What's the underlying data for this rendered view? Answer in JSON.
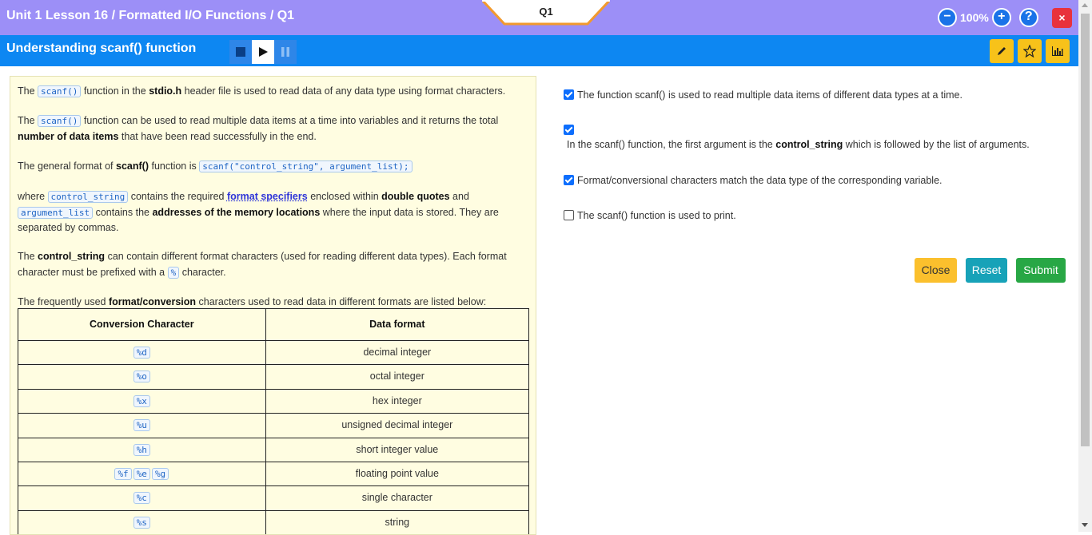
{
  "header": {
    "breadcrumb": "Unit 1 Lesson 16 / Formatted I/O Functions / Q1",
    "question_tab": "Q1",
    "zoom_level": "100%",
    "zoom_out_symbol": "−",
    "zoom_in_symbol": "+",
    "help_symbol": "?",
    "close_symbol": "×"
  },
  "subheader": {
    "title": "Understanding scanf() function"
  },
  "content": {
    "p1": {
      "pre": "The",
      "code": "scanf()",
      "mid": "function in the",
      "bold": "stdio.h",
      "post": "header file is used to read data of any data type using format characters."
    },
    "p2": {
      "pre": "The",
      "code": "scanf()",
      "mid": "function can be used to read multiple data items at a time into variables and it returns the total",
      "bold": "number of data items",
      "post": "that have been read successfully in the end."
    },
    "p3": {
      "pre": "The general format of",
      "bold": "scanf()",
      "mid": "function is",
      "code": "scanf(\"control_string\", argument_list);"
    },
    "p4": {
      "pre": "where",
      "code1": "control_string",
      "t1": "contains the required",
      "link": "format specifiers",
      "t2": "enclosed within",
      "bold1": "double quotes",
      "t3": "and",
      "code2": "argument_list",
      "t4": "contains the",
      "bold2": "addresses of the memory locations",
      "t5": "where the input data is stored. They are separated by commas."
    },
    "p5": {
      "pre": "The",
      "bold": "control_string",
      "mid": "can contain different format characters (used for reading different data types). Each format character must be prefixed with a",
      "code": "%",
      "post": "character."
    },
    "p6": {
      "pre": "The frequently used",
      "bold": "format/conversion",
      "post": "characters used to read data in different formats are listed below:"
    },
    "table": {
      "headers": [
        "Conversion Character",
        "Data format"
      ],
      "rows": [
        {
          "codes": [
            "%d"
          ],
          "format": "decimal integer"
        },
        {
          "codes": [
            "%o"
          ],
          "format": "octal integer"
        },
        {
          "codes": [
            "%x"
          ],
          "format": "hex integer"
        },
        {
          "codes": [
            "%u"
          ],
          "format": "unsigned decimal integer"
        },
        {
          "codes": [
            "%h"
          ],
          "format": "short integer value"
        },
        {
          "codes": [
            "%f",
            "%e",
            "%g"
          ],
          "format": "floating point value"
        },
        {
          "codes": [
            "%c"
          ],
          "format": "single character"
        },
        {
          "codes": [
            "%s"
          ],
          "format": "string"
        }
      ]
    }
  },
  "options": [
    {
      "checked": true,
      "text": "The function scanf() is used to read multiple data items of different data types at a time."
    },
    {
      "checked": true,
      "pre": "In the scanf() function, the first argument is the",
      "bold": "control_string",
      "post": "which is followed by the list of arguments."
    },
    {
      "checked": true,
      "text": "Format/conversional characters match the data type of the corresponding variable."
    },
    {
      "checked": false,
      "text": "The scanf() function is used to print."
    }
  ],
  "actions": {
    "close": "Close",
    "reset": "Reset",
    "submit": "Submit"
  },
  "colors": {
    "header_bg": "#9c8ff7",
    "subheader_bg": "#0d87f2",
    "close_btn": "#fbc02d",
    "reset_btn": "#17a2b8",
    "submit_btn": "#28a745"
  },
  "icons": {
    "edit": "pencil-icon",
    "bookmark": "star-icon",
    "stats": "bar-chart-icon",
    "stop": "stop-icon",
    "play": "play-icon",
    "pause": "pause-icon"
  }
}
